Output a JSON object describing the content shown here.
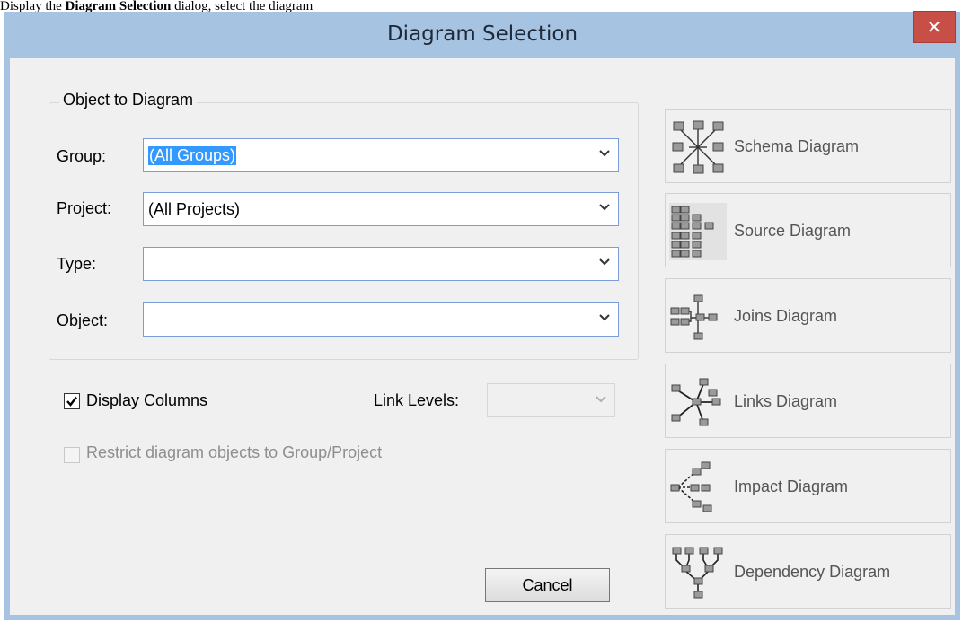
{
  "snippet": {
    "before": "Display the",
    "bold": "Diagram Selection",
    "after": "dialog, select the diagram"
  },
  "window": {
    "title": "Diagram Selection",
    "close_label": "✕"
  },
  "object_group": {
    "legend": "Object to Diagram",
    "group_label": "Group:",
    "group_value": "(All Groups)",
    "project_label": "Project:",
    "project_value": "(All Projects)",
    "type_label": "Type:",
    "type_value": "",
    "object_label": "Object:",
    "object_value": ""
  },
  "options": {
    "display_columns_label": "Display Columns",
    "display_columns_checked": true,
    "link_levels_label": "Link Levels:",
    "link_levels_value": "",
    "restrict_label": "Restrict diagram objects to Group/Project",
    "restrict_checked": false
  },
  "buttons": {
    "cancel": "Cancel"
  },
  "diagram_buttons": [
    {
      "label": "Schema Diagram",
      "icon": "schema-diagram-icon"
    },
    {
      "label": "Source Diagram",
      "icon": "source-diagram-icon"
    },
    {
      "label": "Joins Diagram",
      "icon": "joins-diagram-icon"
    },
    {
      "label": "Links Diagram",
      "icon": "links-diagram-icon"
    },
    {
      "label": "Impact Diagram",
      "icon": "impact-diagram-icon"
    },
    {
      "label": "Dependency Diagram",
      "icon": "dependency-diagram-icon"
    }
  ],
  "colors": {
    "titlebar": "#a7c3e2",
    "close_button": "#c74f47",
    "selection": "#3399ff",
    "combo_border": "#7a9cd8"
  }
}
